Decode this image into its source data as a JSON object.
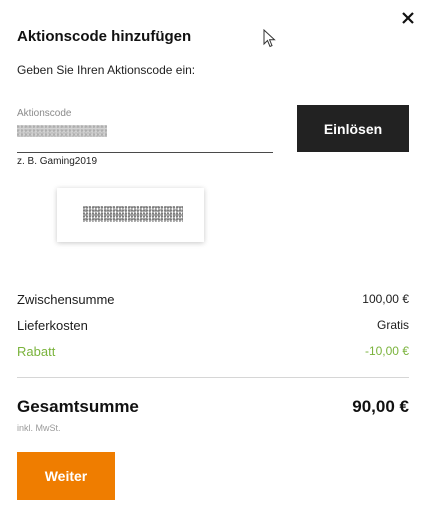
{
  "dialog": {
    "title": "Aktionscode hinzufügen",
    "subtitle": "Geben Sie Ihren Aktionscode ein:",
    "close_icon": "close-icon"
  },
  "promo": {
    "field_label": "Aktionscode",
    "hint": "z. B. Gaming2019",
    "redeem_label": "Einlösen"
  },
  "summary": {
    "rows": [
      {
        "label": "Zwischensumme",
        "value": "100,00 €"
      },
      {
        "label": "Lieferkosten",
        "value": "Gratis"
      },
      {
        "label": "Rabatt",
        "value": "-10,00 €"
      }
    ],
    "total_label": "Gesamtsumme",
    "total_value": "90,00 €",
    "tax_note": "inkl. MwSt."
  },
  "actions": {
    "next_label": "Weiter"
  },
  "colors": {
    "accent": "#ef7d00",
    "discount": "#7ab33c",
    "dark_button": "#222222"
  }
}
